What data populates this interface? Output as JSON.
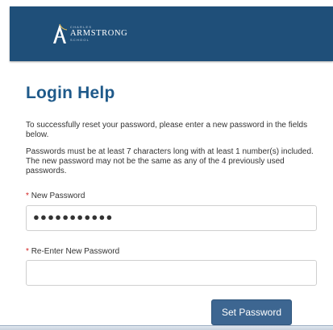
{
  "logo": {
    "top_text": "CHARLES",
    "name": "ARMSTRONG",
    "bottom_text": "SCHOOL"
  },
  "page": {
    "title": "Login Help",
    "instructions": "To successfully reset your password, please enter a new password in the fields below.",
    "requirements": "Passwords must be at least 7 characters long with at least 1 number(s) included. The new password may not be the same as any of the 4 previously used passwords."
  },
  "form": {
    "required_marker": "*",
    "new_password_label": "New Password",
    "new_password_value": "●●●●●●●●●●●",
    "reenter_label": "Re-Enter New Password",
    "reenter_value": "",
    "submit_label": "Set Password"
  },
  "colors": {
    "header": "#1f4f79",
    "title": "#1f5a8a",
    "button": "#3d6691",
    "required": "#d21e1e"
  }
}
